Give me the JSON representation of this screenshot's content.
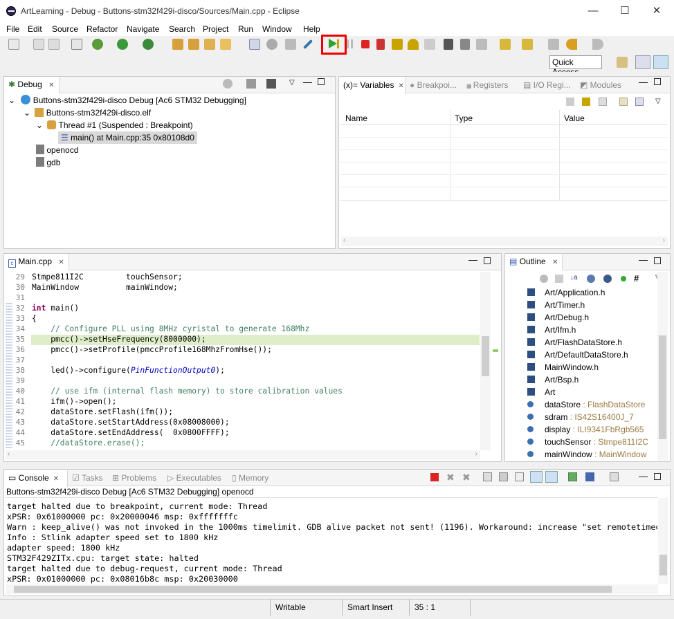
{
  "window": {
    "title": "ArtLearning - Debug - Buttons-stm32f429i-disco/Sources/Main.cpp - Eclipse",
    "minimize": "—",
    "maximize": "☐",
    "close": "✕"
  },
  "menu": [
    "File",
    "Edit",
    "Source",
    "Refactor",
    "Navigate",
    "Search",
    "Project",
    "Run",
    "Window",
    "Help"
  ],
  "toolbar": {
    "quick_access": "Quick Access",
    "highlighted_button": "resume-icon"
  },
  "debug_view": {
    "tab": "Debug",
    "tree": [
      {
        "label": "Buttons-stm32f429i-disco Debug [Ac6 STM32 Debugging]",
        "icon": "launch-icon"
      },
      {
        "label": "Buttons-stm32f429i-disco.elf",
        "icon": "process-icon"
      },
      {
        "label": "Thread #1 (Suspended : Breakpoint)",
        "icon": "thread-icon"
      },
      {
        "label": "main() at Main.cpp:35 0x80108d0",
        "icon": "stackframe-icon"
      },
      {
        "label": "openocd",
        "icon": "process-icon"
      },
      {
        "label": "gdb",
        "icon": "process-icon"
      }
    ]
  },
  "variables_view": {
    "tabs": [
      "(x)= Variables",
      "Breakpoi...",
      "Registers",
      "I/O Regi...",
      "Modules"
    ],
    "columns": [
      "Name",
      "Type",
      "Value"
    ]
  },
  "editor": {
    "tab": "Main.cpp",
    "lines": [
      {
        "n": "29",
        "text": "Stmpe811I2C         touchSensor;"
      },
      {
        "n": "30",
        "text": "MainWindow          mainWindow;"
      },
      {
        "n": "31",
        "text": ""
      },
      {
        "n": "32",
        "text": "int main()"
      },
      {
        "n": "33",
        "text": "{"
      },
      {
        "n": "34",
        "text": "    // Configure PLL using 8MHz cyristal to generate 168Mhz"
      },
      {
        "n": "35",
        "text": "    pmcc()->setHseFrequency(8000000);"
      },
      {
        "n": "36",
        "text": "    pmcc()->setProfile(pmccProfile168MhzFromHse());"
      },
      {
        "n": "37",
        "text": ""
      },
      {
        "n": "38",
        "text": "    led()->configure(PinFunctionOutput0);"
      },
      {
        "n": "39",
        "text": ""
      },
      {
        "n": "40",
        "text": "    // use ifm (internal flash memory) to store calibration values"
      },
      {
        "n": "41",
        "text": "    ifm()->open();"
      },
      {
        "n": "42",
        "text": "    dataStore.setFlash(ifm());"
      },
      {
        "n": "43",
        "text": "    dataStore.setStartAddress(0x08008000);"
      },
      {
        "n": "44",
        "text": "    dataStore.setEndAddress(  0x0800FFFF);"
      },
      {
        "n": "45",
        "text": "    //dataStore.erase();"
      }
    ]
  },
  "outline_view": {
    "tab": "Outline",
    "items": [
      {
        "name": "Art/Application.h",
        "type": ""
      },
      {
        "name": "Art/Timer.h",
        "type": ""
      },
      {
        "name": "Art/Debug.h",
        "type": ""
      },
      {
        "name": "Art/Ifm.h",
        "type": ""
      },
      {
        "name": "Art/FlashDataStore.h",
        "type": ""
      },
      {
        "name": "Art/DefaultDataStore.h",
        "type": ""
      },
      {
        "name": "MainWindow.h",
        "type": ""
      },
      {
        "name": "Art/Bsp.h",
        "type": ""
      },
      {
        "name": "Art",
        "type": ""
      },
      {
        "name": "dataStore",
        "type": " : FlashDataStore"
      },
      {
        "name": "sdram",
        "type": " : IS42S16400J_7"
      },
      {
        "name": "display",
        "type": " : ILI9341FbRgb565"
      },
      {
        "name": "touchSensor",
        "type": " : Stmpe811I2C"
      },
      {
        "name": "mainWindow",
        "type": " : MainWindow"
      }
    ]
  },
  "console_view": {
    "tabs": [
      "Console",
      "Tasks",
      "Problems",
      "Executables",
      "Memory"
    ],
    "header": "Buttons-stm32f429i-disco Debug [Ac6 STM32 Debugging] openocd",
    "lines": [
      "target halted due to breakpoint, current mode: Thread",
      "xPSR: 0x61000000 pc: 0x20000046 msp: 0xfffffffc",
      "Warn : keep_alive() was not invoked in the 1000ms timelimit. GDB alive packet not sent! (1196). Workaround: increase \"set remotetimeout\"",
      "Info : Stlink adapter speed set to 1800 kHz",
      "adapter speed: 1800 kHz",
      "STM32F429ZITx.cpu: target state: halted",
      "target halted due to debug-request, current mode: Thread",
      "xPSR: 0x01000000 pc: 0x08016b8c msp: 0x20030000"
    ]
  },
  "status": {
    "writable": "Writable",
    "insert_mode": "Smart Insert",
    "position": "35 : 1"
  }
}
